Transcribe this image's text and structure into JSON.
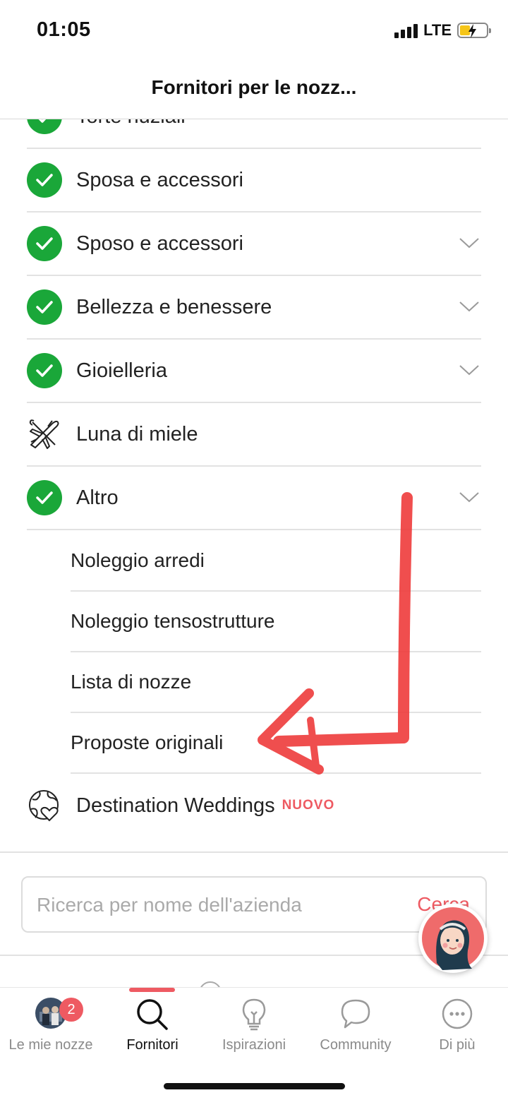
{
  "status": {
    "time": "01:05",
    "network": "LTE"
  },
  "nav": {
    "title": "Fornitori per le nozz..."
  },
  "categories": [
    {
      "label": "Torte nuziali",
      "icon": "check-icon",
      "expandable": false
    },
    {
      "label": "Sposa e accessori",
      "icon": "check-icon",
      "expandable": false
    },
    {
      "label": "Sposo e accessori",
      "icon": "check-icon",
      "expandable": true
    },
    {
      "label": "Bellezza e benessere",
      "icon": "check-icon",
      "expandable": true
    },
    {
      "label": "Gioielleria",
      "icon": "check-icon",
      "expandable": true
    },
    {
      "label": "Luna di miele",
      "icon": "airplanes-icon",
      "expandable": false
    },
    {
      "label": "Altro",
      "icon": "check-icon",
      "expandable": true
    }
  ],
  "altro_subitems": [
    "Noleggio arredi",
    "Noleggio tensostrutture",
    "Lista di nozze",
    "Proposte originali"
  ],
  "destination": {
    "label": "Destination Weddings",
    "badge": "NUOVO",
    "icon": "globe-heart-icon"
  },
  "search": {
    "placeholder": "Ricerca per nome dell'azienda",
    "button": "Cerca"
  },
  "tabs": [
    {
      "label": "Le mie nozze",
      "icon": "avatar-photo-icon",
      "badge": "2"
    },
    {
      "label": "Fornitori",
      "icon": "search-icon",
      "active": true
    },
    {
      "label": "Ispirazioni",
      "icon": "lightbulb-icon"
    },
    {
      "label": "Community",
      "icon": "chat-bubble-icon"
    },
    {
      "label": "Di più",
      "icon": "more-dots-icon"
    }
  ],
  "colors": {
    "accent": "#ee5a62",
    "check_green": "#1aa739",
    "annotation_red": "#ee3b3b"
  }
}
